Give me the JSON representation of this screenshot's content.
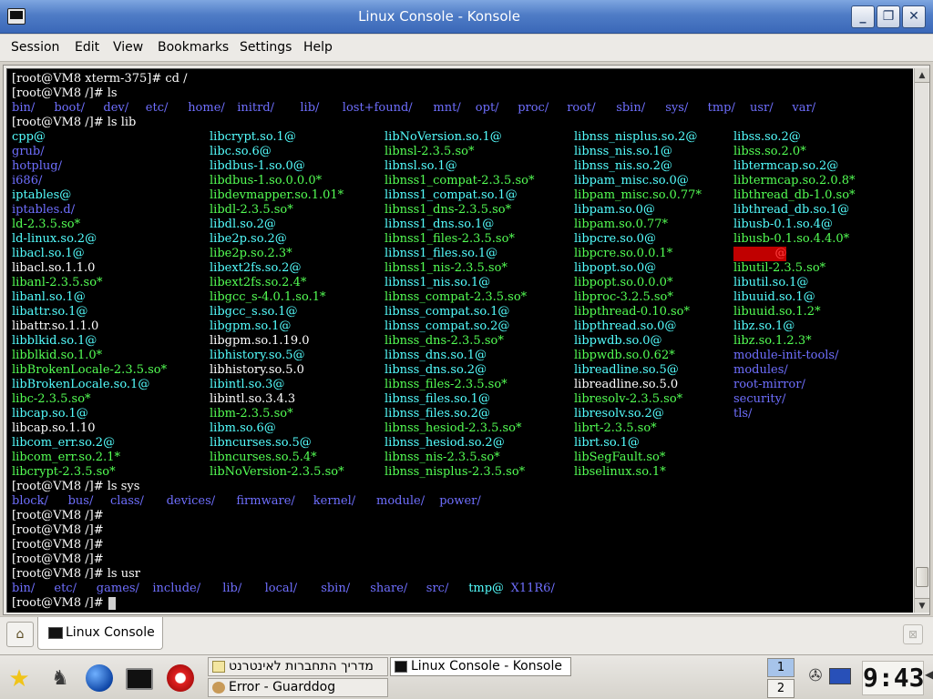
{
  "window": {
    "title": "Linux Console - Konsole",
    "minimize_icon": "minimize-icon",
    "maximize_icon": "maximize-icon",
    "close_icon": "close-icon",
    "min_glyph": "_",
    "max_glyph": "❐",
    "close_glyph": "✕"
  },
  "menubar": {
    "items": [
      "Session",
      "Edit",
      "View",
      "Bookmarks",
      "Settings",
      "Help"
    ]
  },
  "terminal": {
    "colors": {
      "dir": "#6f6fff",
      "exe": "#54ff54",
      "link": "#54ffff",
      "regular": "#ffffff",
      "broken": "#ff4040"
    },
    "lines": [
      [
        [
          "[root@VM8 xterm-375]# cd /",
          "reg"
        ]
      ],
      [
        [
          "[root@VM8 /]# ls",
          "reg"
        ]
      ],
      [
        [
          "bin/",
          "dir"
        ],
        [
          "boot/",
          "dir"
        ],
        [
          "dev/",
          "dir"
        ],
        [
          "etc/",
          "dir"
        ],
        [
          "home/",
          "dir"
        ],
        [
          "initrd/",
          "dir"
        ],
        [
          "lib/",
          "dir"
        ],
        [
          "lost+found/",
          "dir"
        ],
        [
          "mnt/",
          "dir"
        ],
        [
          "opt/",
          "dir"
        ],
        [
          "proc/",
          "dir"
        ],
        [
          "root/",
          "dir"
        ],
        [
          "sbin/",
          "dir"
        ],
        [
          "sys/",
          "dir"
        ],
        [
          "tmp/",
          "dir"
        ],
        [
          "usr/",
          "dir"
        ],
        [
          "var/",
          "dir"
        ]
      ],
      [
        [
          "[root@VM8 /]# ls lib",
          "reg"
        ]
      ],
      [
        [
          "cpp@",
          "link"
        ],
        [
          "libcrypt.so.1@",
          "link"
        ],
        [
          "libNoVersion.so.1@",
          "link"
        ],
        [
          "libnss_nisplus.so.2@",
          "link"
        ],
        [
          "libss.so.2@",
          "link"
        ]
      ],
      [
        [
          "grub/",
          "dir"
        ],
        [
          "libc.so.6@",
          "link"
        ],
        [
          "libnsl-2.3.5.so*",
          "exe"
        ],
        [
          "libnss_nis.so.1@",
          "link"
        ],
        [
          "libss.so.2.0*",
          "exe"
        ]
      ],
      [
        [
          "hotplug/",
          "dir"
        ],
        [
          "libdbus-1.so.0@",
          "link"
        ],
        [
          "libnsl.so.1@",
          "link"
        ],
        [
          "libnss_nis.so.2@",
          "link"
        ],
        [
          "libtermcap.so.2@",
          "link"
        ]
      ],
      [
        [
          "i686/",
          "dir"
        ],
        [
          "libdbus-1.so.0.0.0*",
          "exe"
        ],
        [
          "libnss1_compat-2.3.5.so*",
          "exe"
        ],
        [
          "libpam_misc.so.0@",
          "link"
        ],
        [
          "libtermcap.so.2.0.8*",
          "exe"
        ]
      ],
      [
        [
          "iptables@",
          "link"
        ],
        [
          "libdevmapper.so.1.01*",
          "exe"
        ],
        [
          "libnss1_compat.so.1@",
          "link"
        ],
        [
          "libpam_misc.so.0.77*",
          "exe"
        ],
        [
          "libthread_db-1.0.so*",
          "exe"
        ]
      ],
      [
        [
          "iptables.d/",
          "dir"
        ],
        [
          "libdl-2.3.5.so*",
          "exe"
        ],
        [
          "libnss1_dns-2.3.5.so*",
          "exe"
        ],
        [
          "libpam.so.0@",
          "link"
        ],
        [
          "libthread_db.so.1@",
          "link"
        ]
      ],
      [
        [
          "ld-2.3.5.so*",
          "exe"
        ],
        [
          "libdl.so.2@",
          "link"
        ],
        [
          "libnss1_dns.so.1@",
          "link"
        ],
        [
          "libpam.so.0.77*",
          "exe"
        ],
        [
          "libusb-0.1.so.4@",
          "link"
        ]
      ],
      [
        [
          "ld-linux.so.2@",
          "link"
        ],
        [
          "libe2p.so.2@",
          "link"
        ],
        [
          "libnss1_files-2.3.5.so*",
          "exe"
        ],
        [
          "libpcre.so.0@",
          "link"
        ],
        [
          "libusb-0.1.so.4.4.0*",
          "exe"
        ]
      ],
      [
        [
          "libacl.so.1@",
          "link"
        ],
        [
          "libe2p.so.2.3*",
          "exe"
        ],
        [
          "libnss1_files.so.1@",
          "link"
        ],
        [
          "libpcre.so.0.0.1*",
          "exe"
        ],
        [
          "           @",
          "bad"
        ]
      ],
      [
        [
          "libacl.so.1.1.0",
          "reg"
        ],
        [
          "libext2fs.so.2@",
          "link"
        ],
        [
          "libnss1_nis-2.3.5.so*",
          "exe"
        ],
        [
          "libpopt.so.0@",
          "link"
        ],
        [
          "libutil-2.3.5.so*",
          "exe"
        ]
      ],
      [
        [
          "libanl-2.3.5.so*",
          "exe"
        ],
        [
          "libext2fs.so.2.4*",
          "exe"
        ],
        [
          "libnss1_nis.so.1@",
          "link"
        ],
        [
          "libpopt.so.0.0.0*",
          "exe"
        ],
        [
          "libutil.so.1@",
          "link"
        ]
      ],
      [
        [
          "libanl.so.1@",
          "link"
        ],
        [
          "libgcc_s-4.0.1.so.1*",
          "exe"
        ],
        [
          "libnss_compat-2.3.5.so*",
          "exe"
        ],
        [
          "libproc-3.2.5.so*",
          "exe"
        ],
        [
          "libuuid.so.1@",
          "link"
        ]
      ],
      [
        [
          "libattr.so.1@",
          "link"
        ],
        [
          "libgcc_s.so.1@",
          "link"
        ],
        [
          "libnss_compat.so.1@",
          "link"
        ],
        [
          "libpthread-0.10.so*",
          "exe"
        ],
        [
          "libuuid.so.1.2*",
          "exe"
        ]
      ],
      [
        [
          "libattr.so.1.1.0",
          "reg"
        ],
        [
          "libgpm.so.1@",
          "link"
        ],
        [
          "libnss_compat.so.2@",
          "link"
        ],
        [
          "libpthread.so.0@",
          "link"
        ],
        [
          "libz.so.1@",
          "link"
        ]
      ],
      [
        [
          "libblkid.so.1@",
          "link"
        ],
        [
          "libgpm.so.1.19.0",
          "reg"
        ],
        [
          "libnss_dns-2.3.5.so*",
          "exe"
        ],
        [
          "libpwdb.so.0@",
          "link"
        ],
        [
          "libz.so.1.2.3*",
          "exe"
        ]
      ],
      [
        [
          "libblkid.so.1.0*",
          "exe"
        ],
        [
          "libhistory.so.5@",
          "link"
        ],
        [
          "libnss_dns.so.1@",
          "link"
        ],
        [
          "libpwdb.so.0.62*",
          "exe"
        ],
        [
          "module-init-tools/",
          "dir"
        ]
      ],
      [
        [
          "libBrokenLocale-2.3.5.so*",
          "exe"
        ],
        [
          "libhistory.so.5.0",
          "reg"
        ],
        [
          "libnss_dns.so.2@",
          "link"
        ],
        [
          "libreadline.so.5@",
          "link"
        ],
        [
          "modules/",
          "dir"
        ]
      ],
      [
        [
          "libBrokenLocale.so.1@",
          "link"
        ],
        [
          "libintl.so.3@",
          "link"
        ],
        [
          "libnss_files-2.3.5.so*",
          "exe"
        ],
        [
          "libreadline.so.5.0",
          "reg"
        ],
        [
          "root-mirror/",
          "dir"
        ]
      ],
      [
        [
          "libc-2.3.5.so*",
          "exe"
        ],
        [
          "libintl.so.3.4.3",
          "reg"
        ],
        [
          "libnss_files.so.1@",
          "link"
        ],
        [
          "libresolv-2.3.5.so*",
          "exe"
        ],
        [
          "security/",
          "dir"
        ]
      ],
      [
        [
          "libcap.so.1@",
          "link"
        ],
        [
          "libm-2.3.5.so*",
          "exe"
        ],
        [
          "libnss_files.so.2@",
          "link"
        ],
        [
          "libresolv.so.2@",
          "link"
        ],
        [
          "tls/",
          "dir"
        ]
      ],
      [
        [
          "libcap.so.1.10",
          "reg"
        ],
        [
          "libm.so.6@",
          "link"
        ],
        [
          "libnss_hesiod-2.3.5.so*",
          "exe"
        ],
        [
          "librt-2.3.5.so*",
          "exe"
        ]
      ],
      [
        [
          "libcom_err.so.2@",
          "link"
        ],
        [
          "libncurses.so.5@",
          "link"
        ],
        [
          "libnss_hesiod.so.2@",
          "link"
        ],
        [
          "librt.so.1@",
          "link"
        ]
      ],
      [
        [
          "libcom_err.so.2.1*",
          "exe"
        ],
        [
          "libncurses.so.5.4*",
          "exe"
        ],
        [
          "libnss_nis-2.3.5.so*",
          "exe"
        ],
        [
          "libSegFault.so*",
          "exe"
        ]
      ],
      [
        [
          "libcrypt-2.3.5.so*",
          "exe"
        ],
        [
          "libNoVersion-2.3.5.so*",
          "exe"
        ],
        [
          "libnss_nisplus-2.3.5.so*",
          "exe"
        ],
        [
          "libselinux.so.1*",
          "exe"
        ]
      ],
      [
        [
          "[root@VM8 /]# ls sys",
          "reg"
        ]
      ],
      [
        [
          "block/",
          "dir"
        ],
        [
          "bus/",
          "dir"
        ],
        [
          "class/",
          "dir"
        ],
        [
          "devices/",
          "dir"
        ],
        [
          "firmware/",
          "dir"
        ],
        [
          "kernel/",
          "dir"
        ],
        [
          "module/",
          "dir"
        ],
        [
          "power/",
          "dir"
        ]
      ],
      [
        [
          "[root@VM8 /]#",
          "reg"
        ]
      ],
      [
        [
          "[root@VM8 /]#",
          "reg"
        ]
      ],
      [
        [
          "[root@VM8 /]#",
          "reg"
        ]
      ],
      [
        [
          "[root@VM8 /]#",
          "reg"
        ]
      ],
      [
        [
          "[root@VM8 /]# ls usr",
          "reg"
        ]
      ],
      [
        [
          "bin/",
          "dir"
        ],
        [
          "etc/",
          "dir"
        ],
        [
          "games/",
          "dir"
        ],
        [
          "include/",
          "dir"
        ],
        [
          "lib/",
          "dir"
        ],
        [
          "local/",
          "dir"
        ],
        [
          "sbin/",
          "dir"
        ],
        [
          "share/",
          "dir"
        ],
        [
          "src/",
          "dir"
        ],
        [
          "tmp@",
          "link"
        ],
        [
          "X11R6/",
          "dir"
        ]
      ],
      [
        [
          "[root@VM8 /]# ",
          "reg"
        ]
      ]
    ]
  },
  "tabs": {
    "new_tab_icon": "new-session-icon",
    "items": [
      {
        "label": "Linux Console",
        "icon": "terminal-icon"
      }
    ],
    "close_icon": "close-tab-icon"
  },
  "taskbar": {
    "launchers": [
      "star-icon",
      "kde-menu-icon",
      "browser-globe-icon",
      "terminal-icon",
      "guarddog-icon"
    ],
    "tasks": [
      {
        "label": "מדריך התחברות לאינטרנט",
        "icon": "help-icon"
      },
      {
        "label": "Linux Console - Konsole",
        "icon": "terminal-icon",
        "active": true
      },
      {
        "label": "Error - Guarddog",
        "icon": "guarddog-icon"
      }
    ],
    "pager": [
      "1",
      "2"
    ],
    "clock": "9:43"
  }
}
